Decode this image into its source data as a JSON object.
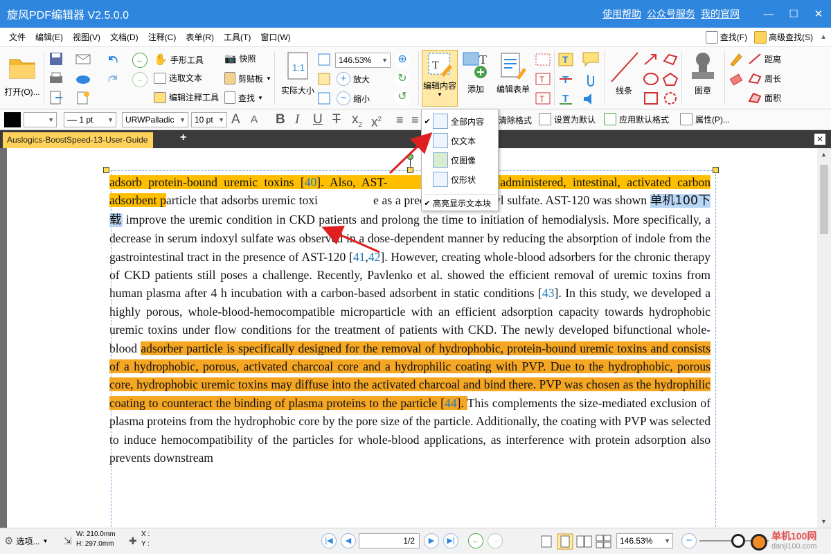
{
  "title_bar": {
    "app_title": "旋风PDF编辑器 V2.5.0.0",
    "links": [
      "使用帮助",
      "公众号服务",
      "我的官网"
    ]
  },
  "menu_bar": {
    "items": [
      "文件",
      "编辑(E)",
      "视图(V)",
      "文档(D)",
      "注释(C)",
      "表单(R)",
      "工具(T)",
      "窗口(W)"
    ],
    "find_label": "查找(F)",
    "advanced_find_label": "高级查找(S)"
  },
  "ribbon": {
    "open_label": "打开(O)...",
    "hand_tool": "手形工具",
    "select_text": "选取文本",
    "edit_annot_tool": "编辑注释工具",
    "snapshot": "快照",
    "clipboard": "剪贴板",
    "find": "查找",
    "actual_size": "实际大小",
    "zoom_value": "146.53%",
    "zoom_in": "放大",
    "zoom_out": "缩小",
    "edit_content": "编辑内容",
    "add": "添加",
    "edit_form": "编辑表单",
    "line": "线条",
    "stamp": "图章",
    "distance": "距离",
    "perimeter": "周长",
    "area": "面积"
  },
  "format_bar": {
    "line_width": "1 pt",
    "font_name": "URWPalladic",
    "font_size": "10 pt",
    "clear_format": "清除格式",
    "set_default": "设置为默认",
    "apply_default": "应用默认格式",
    "properties": "属性(P)..."
  },
  "document_tab": {
    "name": "Auslogics-BoostSpeed-13-User-Guide"
  },
  "dropdown": {
    "items": [
      "全部内容",
      "仅文本",
      "仅图像",
      "仅形状"
    ],
    "checked_item": "全部内容",
    "highlight_option": "高亮显示文本块"
  },
  "document": {
    "seg1_hl": "adsorb protein-bound uremic toxins [",
    "cite40": "40",
    "seg2_hl": "]. Also, AST-",
    "seg3_hl": "ly administered, intestinal, activated carbon adsorbent p",
    "seg4": "article that adsorbs uremic toxi",
    "seg5": "e as a precursor of indoxyl sulfate. AST-120 was shown ",
    "selected_text": "单机100下载",
    "seg6": " improve the uremic condition in CKD patients and prolong the time to initiation of hemodialysis. More specifically, a decrease in serum indoxyl sulfate was observed in a dose-dependent manner by reducing the absorption of indole from the gastrointestinal tract in the presence of AST-120 [",
    "cite41": "41",
    "cite42": "42",
    "seg7": "]. However, creating whole-blood adsorbers for the chronic therapy of CKD patients still poses a challenge. Recently, Pavlenko et al. showed the efficient removal of uremic toxins from human plasma after 4 h incubation with a carbon-based adsorbent in static conditions [",
    "cite43": "43",
    "seg8": "]. In this study, we developed a highly porous, whole-blood-hemocompatible microparticle with an efficient adsorption capacity towards hydrophobic uremic toxins under flow conditions for the treatment of patients with CKD. The newly developed bifunctional whole-blood ",
    "seg9_hl": "adsorber particle is specifically designed for the removal of hydrophobic, protein-bound uremic toxins and consists of a hydrophobic, porous, activated charcoal core and a hydrophilic coating with PVP. Due to the hydrophobic, porous core, hydrophobic uremic toxins may diffuse into the activated charcoal and bind there. PVP was chosen as the hydrophilic coating to counteract the binding of plasma proteins to the particle [",
    "cite44": "44",
    "seg10_hl": "]. ",
    "seg11": "This complements the size-mediated exclusion of plasma proteins from the hydrophobic core by the pore size of the particle. Additionally, the coating with PVP was selected to induce hemocompatibility of the particles for whole-blood applications, as interference with protein adsorption also prevents downstream"
  },
  "status_bar": {
    "options": "选项...",
    "width": "W: 210.0mm",
    "height": "H: 297.0mm",
    "x": "X :",
    "y": "Y :",
    "page_indicator": "1/2",
    "zoom_value": "146.53%",
    "watermark": "单机100网",
    "watermark_url": "danji100.com"
  },
  "colors": {
    "title_bar": "#2e86de",
    "highlight_yellow": "#ffbf00",
    "highlight_orange": "#f5a623",
    "selection": "#b8d6f5",
    "arrow": "#e02020"
  }
}
